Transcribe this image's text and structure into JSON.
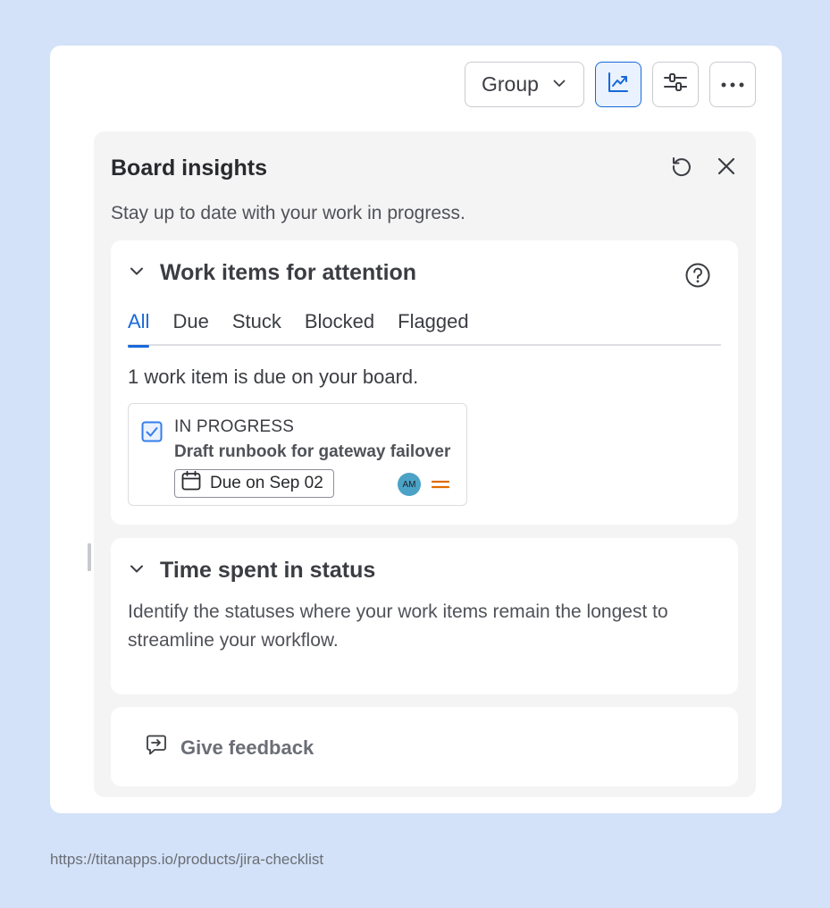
{
  "toolbar": {
    "group_label": "Group",
    "buttons": [
      "chart-icon",
      "sliders-icon",
      "more-icon"
    ]
  },
  "panel": {
    "title": "Board insights",
    "subtitle": "Stay up to date with your work in progress."
  },
  "attention": {
    "title": "Work items for attention",
    "tabs": [
      {
        "label": "All",
        "active": true
      },
      {
        "label": "Due",
        "active": false
      },
      {
        "label": "Stuck",
        "active": false
      },
      {
        "label": "Blocked",
        "active": false
      },
      {
        "label": "Flagged",
        "active": false
      }
    ],
    "summary": "1 work item is due on your board.",
    "item": {
      "status": "IN PROGRESS",
      "title": "Draft runbook for gateway failover",
      "due": "Due on Sep 02",
      "assignee_initials": "AM",
      "priority": "medium"
    }
  },
  "time_in_status": {
    "title": "Time spent in status",
    "description": "Identify the statuses where your work items remain the longest to streamline your workflow."
  },
  "feedback": {
    "label": "Give feedback"
  },
  "footer": {
    "url": "https://titanapps.io/products/jira-checklist"
  },
  "colors": {
    "accent": "#1868db",
    "page_background": "#d3e2f8",
    "avatar": "#4ba2c7",
    "priority_medium": "#e06c00"
  }
}
